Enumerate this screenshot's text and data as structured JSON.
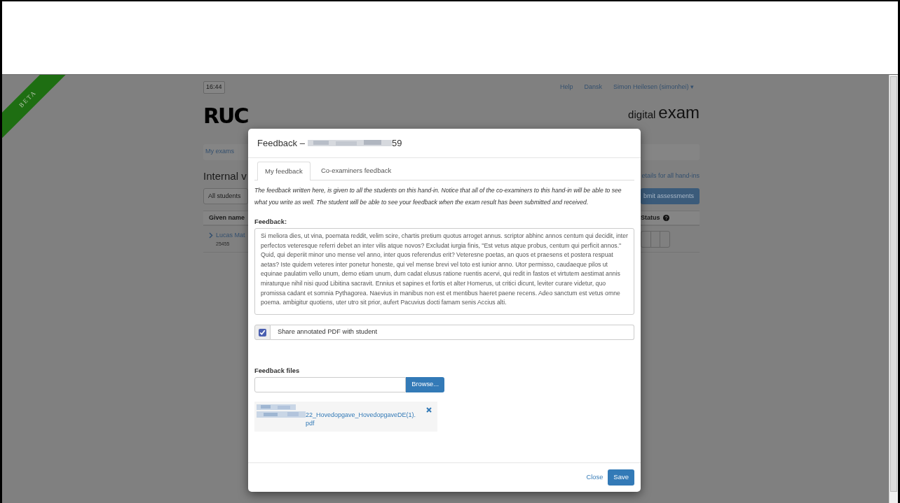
{
  "beta_ribbon": {
    "text": "BETA"
  },
  "header": {
    "clock": "16:44",
    "logo": "RUC",
    "nav_links": [
      {
        "label": "Help"
      },
      {
        "label": "Dansk"
      },
      {
        "label": "Simon Heilesen (simonhei) ▾"
      }
    ],
    "product": {
      "light": "digital",
      "bold": "exam"
    }
  },
  "breadcrumb": [
    {
      "label": "My exams"
    }
  ],
  "page_title": "Internal v",
  "details_link": "etails for all hand-ins",
  "filter": {
    "value": "All students"
  },
  "submit_button": "bmit assessments",
  "table": {
    "columns": [
      {
        "label": "Given name"
      },
      {
        "label": "Status"
      }
    ],
    "rows": [
      {
        "name": "Lucas Mat",
        "number": "25455"
      }
    ]
  },
  "modal": {
    "title": "Feedback –",
    "title_suffix": "59",
    "tabs": [
      {
        "label": "My feedback",
        "selected": true
      },
      {
        "label": "Co-examiners feedback",
        "selected": false
      }
    ],
    "notice": "The feedback written here, is given to all the students on this hand-in. Notice that all of the co-examiners to this hand-in will be able to see what you write as well. The student will be able to see your feedback when the exam result has been submitted and received.",
    "feedback_label": "Feedback:",
    "feedback_text": "Si meliora dies, ut vina, poemata reddit, velim scire, chartis pretium quotus arroget annus. scriptor abhinc annos centum qui decidit, inter perfectos veteresque referri debet an inter vilis atque novos? Excludat iurgia finis, \"Est vetus atque probus, centum qui perficit annos.\" Quid, qui deperiit minor uno mense vel anno, inter quos referendus erit? Veteresne poetas, an quos et praesens et postera respuat aetas? Iste quidem veteres inter ponetur honeste, qui vel mense brevi vel toto est iunior anno. Utor permisso, caudaeque pilos ut equinae paulatim vello unum, demo etiam unum, dum cadat elusus ratione ruentis acervi, qui redit in fastos et virtutem aestimat annis miraturque nihil nisi quod Libitina sacravit. Ennius et sapines et fortis et alter Homerus, ut critici dicunt, leviter curare videtur, quo promissa cadant et somnia Pythagorea. Naevius in manibus non est et mentibus haeret paene recens. Adeo sanctum est vetus omne poema. ambigitur quotiens, uter utro sit prior, aufert Pacuvius docti famam senis Accius alti.",
    "share_pdf": {
      "label": "Share annotated PDF with student",
      "checked": true
    },
    "files_label": "Feedback files",
    "browse_button": "Browse...",
    "files": [
      {
        "name": "22_Hovedopgave_HovedopgaveDE(1).pdf"
      }
    ],
    "buttons": {
      "close": "Close",
      "save": "Save"
    }
  }
}
